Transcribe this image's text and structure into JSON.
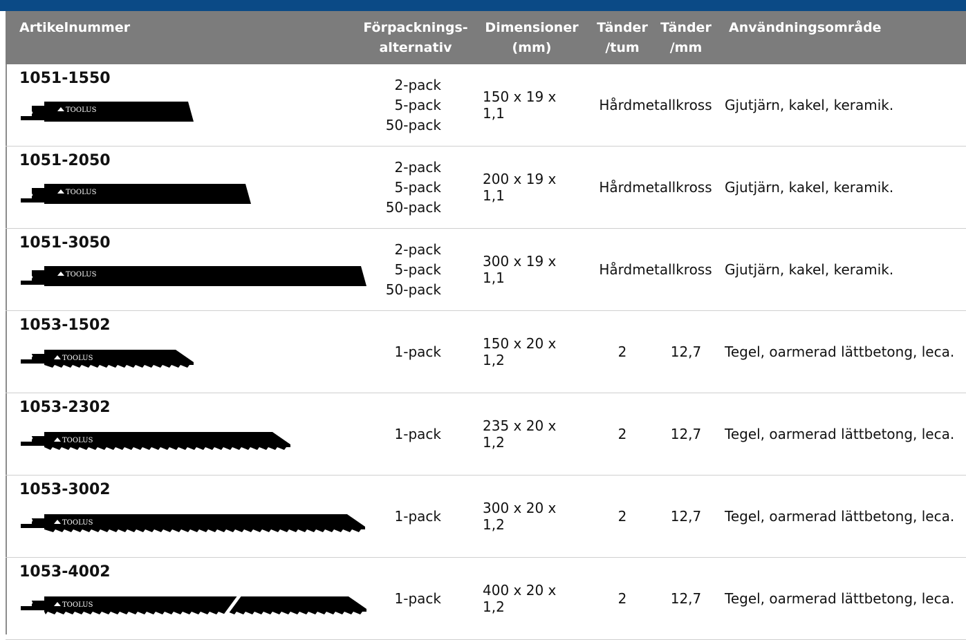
{
  "colors": {
    "topbar": "#0b4a86",
    "header_bg": "#7c7c7c",
    "header_text": "#ffffff"
  },
  "header": {
    "artikelnummer": "Artikelnummer",
    "pack_line1": "Förpacknings-",
    "pack_line2": "alternativ",
    "dim_line1": "Dimensioner",
    "dim_line2": "(mm)",
    "tpi_line1": "Tänder",
    "tpi_line2": "/tum",
    "tpm_line1": "Tänder",
    "tpm_line2": "/mm",
    "use": "Användningsområde"
  },
  "rows": [
    {
      "article": "1051-1550",
      "pack": [
        "2-pack",
        "5-pack",
        "50-pack"
      ],
      "dim": "150 x 19 x 1,1",
      "teeth": "Hårdmetallkross",
      "use": "Gjutjärn, kakel, keramik.",
      "blade_logo": "TOOLUS",
      "blade_type": "grit"
    },
    {
      "article": "1051-2050",
      "pack": [
        "2-pack",
        "5-pack",
        "50-pack"
      ],
      "dim": "200 x 19 x 1,1",
      "teeth": "Hårdmetallkross",
      "use": "Gjutjärn, kakel, keramik.",
      "blade_logo": "TOOLUS",
      "blade_type": "grit"
    },
    {
      "article": "1051-3050",
      "pack": [
        "2-pack",
        "5-pack",
        "50-pack"
      ],
      "dim": "300 x 19 x 1,1",
      "teeth": "Hårdmetallkross",
      "use": "Gjutjärn, kakel, keramik.",
      "blade_logo": "TOOLUS",
      "blade_type": "grit"
    },
    {
      "article": "1053-1502",
      "pack": [
        "1-pack"
      ],
      "dim": "150 x 20 x 1,2",
      "tpi": "2",
      "tpm": "12,7",
      "use": "Tegel, oarmerad lättbetong, leca.",
      "blade_logo": "TOOLUS",
      "blade_type": "toothed"
    },
    {
      "article": "1053-2302",
      "pack": [
        "1-pack"
      ],
      "dim": "235 x 20 x 1,2",
      "tpi": "2",
      "tpm": "12,7",
      "use": "Tegel, oarmerad lättbetong, leca.",
      "blade_logo": "TOOLUS",
      "blade_type": "toothed"
    },
    {
      "article": "1053-3002",
      "pack": [
        "1-pack"
      ],
      "dim": "300 x 20 x 1,2",
      "tpi": "2",
      "tpm": "12,7",
      "use": "Tegel, oarmerad lättbetong, leca.",
      "blade_logo": "TOOLUS",
      "blade_type": "toothed"
    },
    {
      "article": "1053-4002",
      "pack": [
        "1-pack"
      ],
      "dim": "400 x 20 x 1,2",
      "tpi": "2",
      "tpm": "12,7",
      "use": "Tegel, oarmerad lättbetong, leca.",
      "blade_logo": "TOOLUS",
      "blade_type": "toothed-broken"
    }
  ]
}
